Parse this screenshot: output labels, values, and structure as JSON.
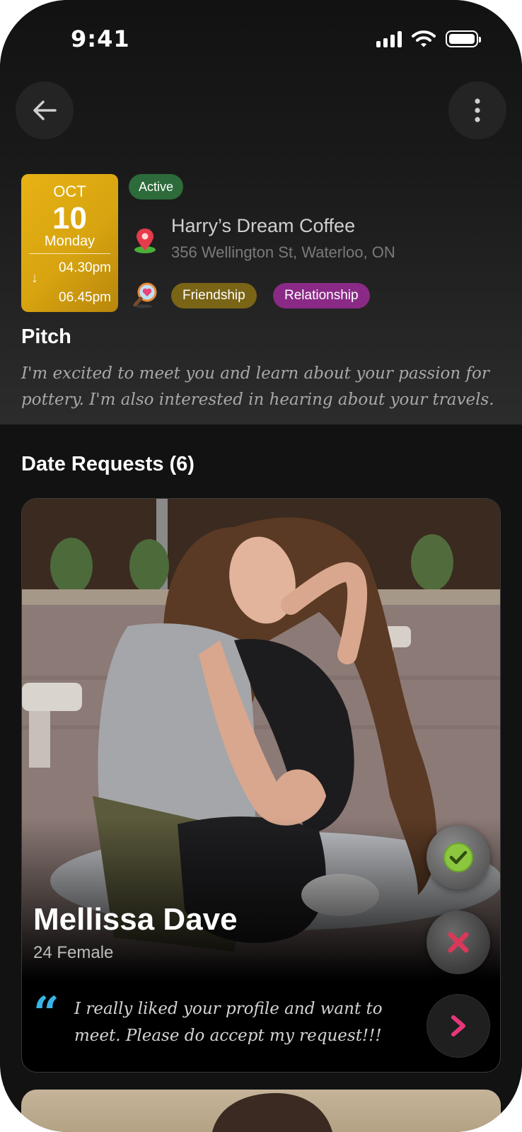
{
  "status_bar": {
    "time": "9:41"
  },
  "event": {
    "month": "OCT",
    "day": "10",
    "weekday": "Monday",
    "start_time": "04.30pm",
    "end_time": "06.45pm",
    "status": "Active",
    "venue_name": "Harry’s Dream Coffee",
    "venue_address": "356 Wellington St, Waterloo, ON",
    "tags": [
      "Friendship",
      "Relationship"
    ],
    "colors": {
      "date_card": "#d8a410",
      "active_badge": "#2d6b3a",
      "friendship_tag": "#7a6416",
      "relationship_tag": "#8a2a86"
    }
  },
  "pitch": {
    "title": "Pitch",
    "text": "I'm excited to meet you and learn about your passion for pottery. I'm also interested in hearing about your travels."
  },
  "requests": {
    "title": "Date Requests (6)",
    "items": [
      {
        "name": "Mellissa Dave",
        "meta": "24 Female",
        "message": "I really liked your profile and want to meet. Please do accept my request!!!"
      }
    ]
  },
  "icons": {
    "back": "back-arrow-icon",
    "more": "more-vertical-icon",
    "location": "location-pin-icon",
    "interest": "search-heart-icon",
    "accept": "check-icon",
    "reject": "close-icon",
    "quote": "quote-icon",
    "next": "chevron-right-icon"
  }
}
